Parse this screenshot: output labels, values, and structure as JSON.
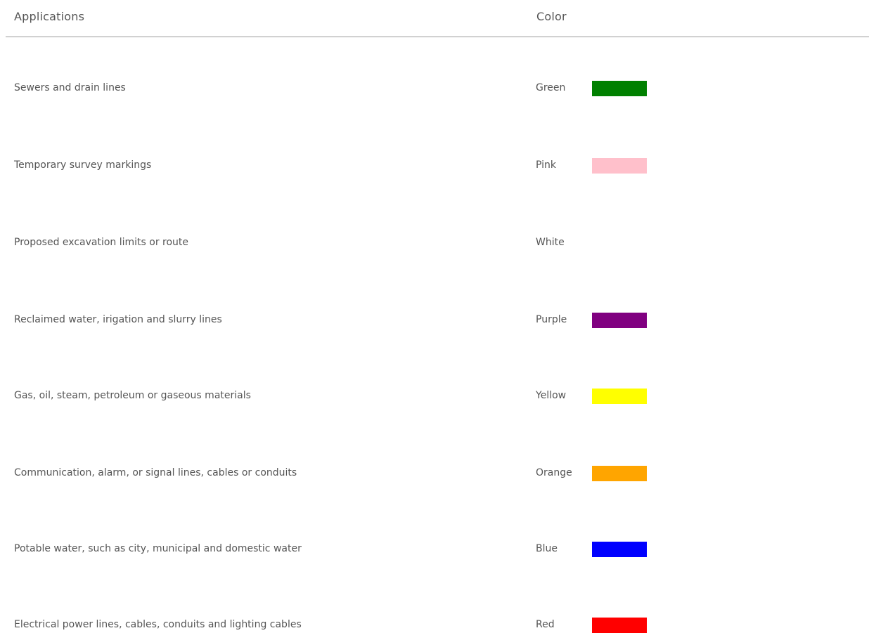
{
  "header": {
    "applications_label": "Applications",
    "color_label": "Color"
  },
  "rows": [
    {
      "application": "Sewers and drain lines",
      "color_name": "Green",
      "swatch": "#008000"
    },
    {
      "application": "Temporary survey markings",
      "color_name": "Pink",
      "swatch": "#ffc0cb"
    },
    {
      "application": "Proposed excavation limits or route",
      "color_name": "White",
      "swatch": "#ffffff"
    },
    {
      "application": "Reclaimed water, irigation and slurry lines",
      "color_name": "Purple",
      "swatch": "#800080"
    },
    {
      "application": "Gas, oil, steam, petroleum or gaseous materials",
      "color_name": "Yellow",
      "swatch": "#ffff00"
    },
    {
      "application": "Communication, alarm, or signal lines, cables or conduits",
      "color_name": "Orange",
      "swatch": "#ffa500"
    },
    {
      "application": "Potable water, such as city, municipal and domestic water",
      "color_name": "Blue",
      "swatch": "#0000ff"
    },
    {
      "application": "Electrical power lines, cables, conduits and lighting cables",
      "color_name": "Red",
      "swatch": "#ff0000"
    }
  ]
}
